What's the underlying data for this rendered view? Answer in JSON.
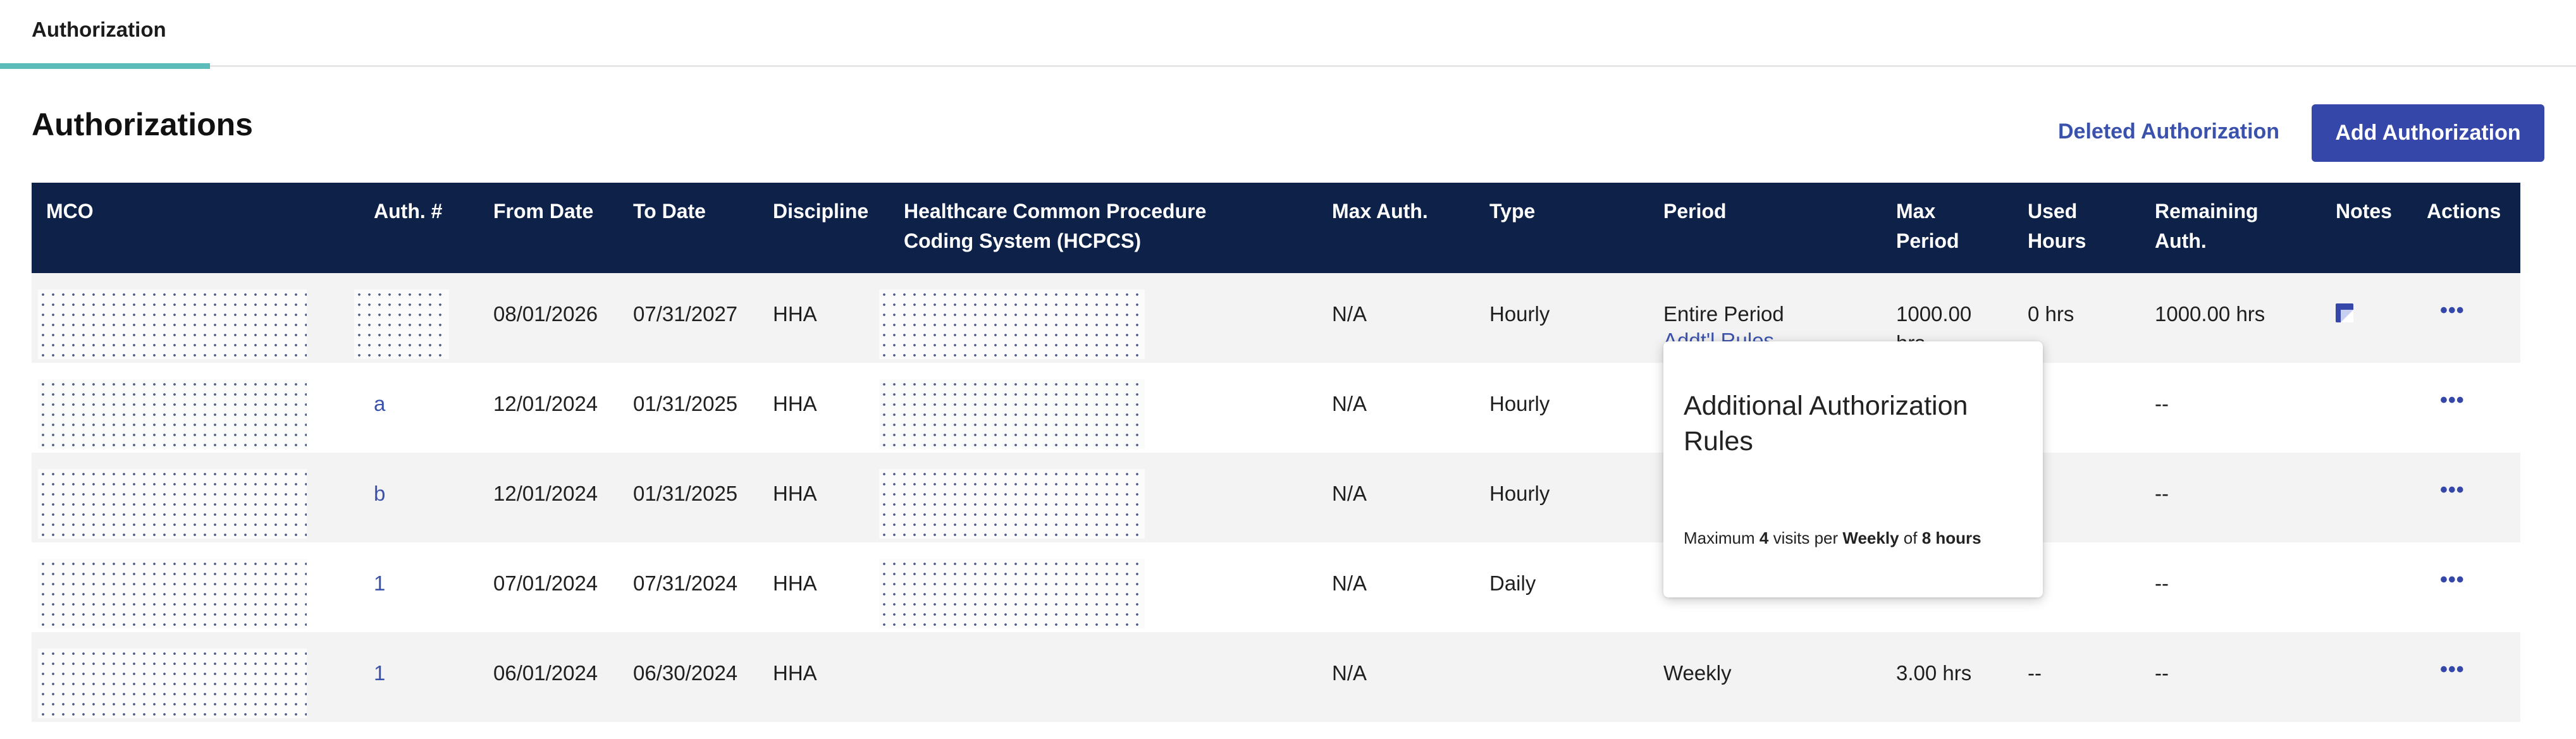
{
  "tabs": [
    {
      "label": "Authorization",
      "active": true
    }
  ],
  "page": {
    "title": "Authorizations",
    "deleted_link": "Deleted Authorization",
    "add_button": "Add Authorization"
  },
  "colors": {
    "header_bg": "#0e2249",
    "accent": "#3547a9",
    "link": "#3b52ad",
    "tab_underline": "#5bbcb9",
    "row_alt": "#f3f3f3"
  },
  "table": {
    "headers": {
      "mco": "MCO",
      "auth": "Auth. #",
      "from": "From Date",
      "to": "To Date",
      "discipline": "Discipline",
      "hcpcs_1": "Healthcare Common Procedure",
      "hcpcs_2": "Coding System (HCPCS)",
      "max_auth": "Max Auth.",
      "type": "Type",
      "period": "Period",
      "max_period_1": "Max",
      "max_period_2": "Period",
      "used_1": "Used",
      "used_2": "Hours",
      "remaining_1": "Remaining",
      "remaining_2": "Auth.",
      "notes": "Notes",
      "actions": "Actions"
    },
    "rows": [
      {
        "auth": "",
        "from": "08/01/2026",
        "to": "07/31/2027",
        "discipline": "HHA",
        "max_auth": "N/A",
        "type": "Hourly",
        "period": "Entire Period",
        "addl_rules": "Addt'l Rules",
        "max_period_1": "1000.00",
        "max_period_2": "hrs",
        "used": "0 hrs",
        "remaining": "1000.00 hrs",
        "actions": "•••"
      },
      {
        "auth": "a",
        "from": "12/01/2024",
        "to": "01/31/2025",
        "discipline": "HHA",
        "max_auth": "N/A",
        "type": "Hourly",
        "period": "",
        "max_period": "",
        "used": "",
        "remaining": "--",
        "actions": "•••"
      },
      {
        "auth": "b",
        "from": "12/01/2024",
        "to": "01/31/2025",
        "discipline": "HHA",
        "max_auth": "N/A",
        "type": "Hourly",
        "period": "",
        "max_period": "",
        "used": "",
        "remaining": "--",
        "actions": "•••"
      },
      {
        "auth": "1",
        "from": "07/01/2024",
        "to": "07/31/2024",
        "discipline": "HHA",
        "max_auth": "N/A",
        "type": "Daily",
        "period": "",
        "max_period": "",
        "used": "",
        "remaining": "--",
        "actions": "•••"
      },
      {
        "auth": "1",
        "from": "06/01/2024",
        "to": "06/30/2024",
        "discipline": "HHA",
        "max_auth": "N/A",
        "type": "",
        "period": "Weekly",
        "max_period": "3.00 hrs",
        "used": "--",
        "remaining": "--",
        "actions": "•••"
      }
    ]
  },
  "popover": {
    "title": "Additional Authorization Rules",
    "text_1": "Maximum ",
    "visits": "4",
    "text_2": " visits per ",
    "frequency": "Weekly",
    "text_3": " of ",
    "hours": "8 hours"
  },
  "icons": {
    "notes": "note-icon",
    "actions": "more-horizontal-icon"
  }
}
